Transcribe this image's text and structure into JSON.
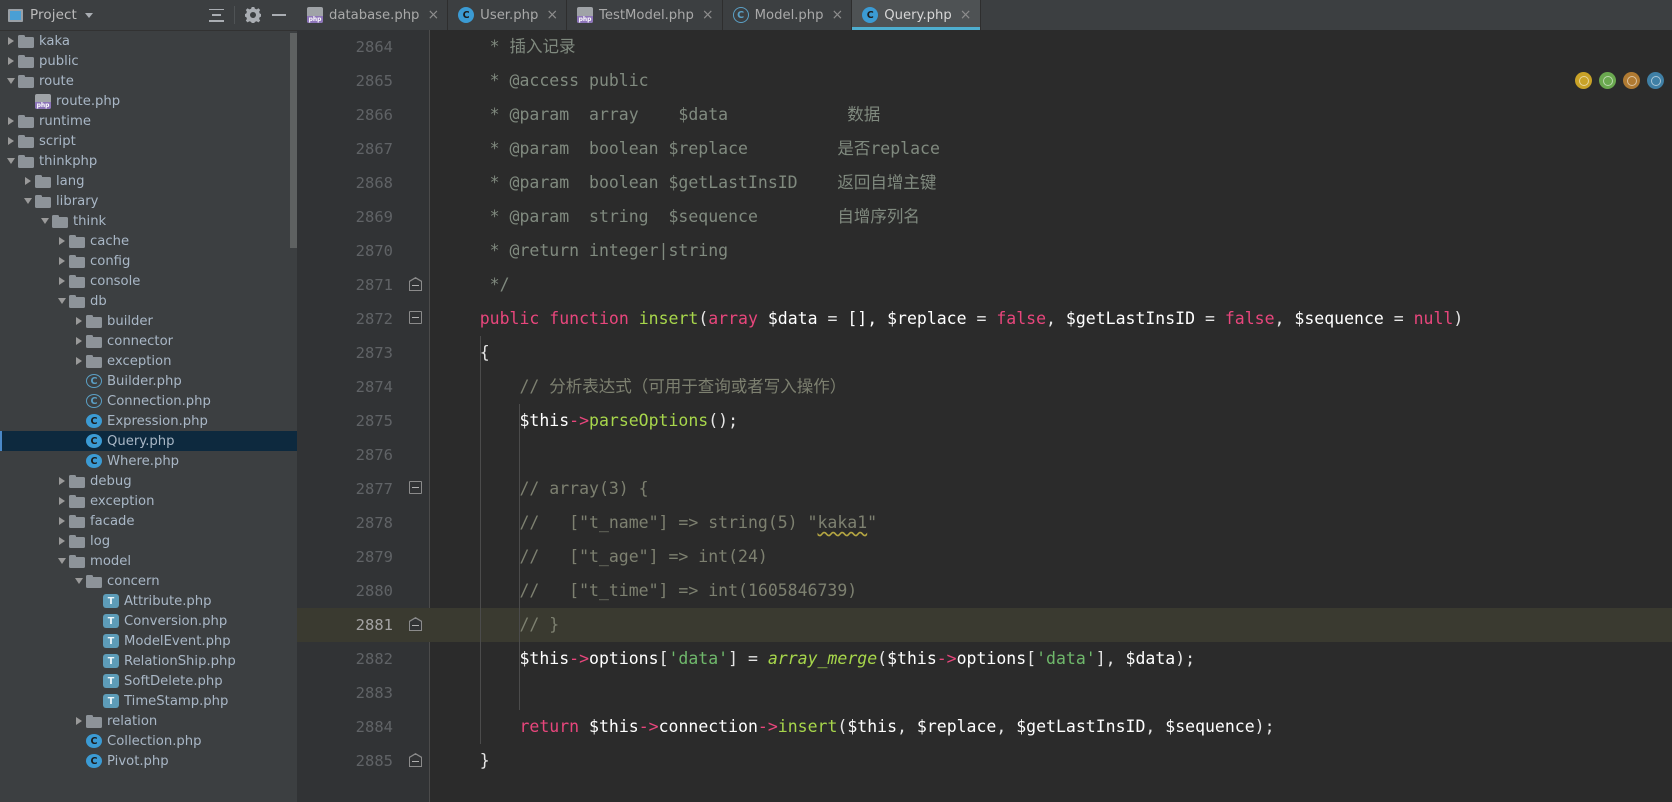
{
  "sidebar": {
    "title": "Project",
    "icons": {
      "project": "project-icon",
      "collapse_all": "collapse-all-icon",
      "settings": "gear-icon",
      "hide": "minimize-icon"
    },
    "tree": [
      {
        "label": "kaka",
        "indent": 1,
        "arrow": "closed",
        "icon": "folder"
      },
      {
        "label": "public",
        "indent": 1,
        "arrow": "closed",
        "icon": "folder"
      },
      {
        "label": "route",
        "indent": 1,
        "arrow": "open",
        "icon": "folder"
      },
      {
        "label": "route.php",
        "indent": 2,
        "arrow": "none",
        "icon": "php"
      },
      {
        "label": "runtime",
        "indent": 1,
        "arrow": "closed",
        "icon": "folder"
      },
      {
        "label": "script",
        "indent": 1,
        "arrow": "closed",
        "icon": "folder"
      },
      {
        "label": "thinkphp",
        "indent": 1,
        "arrow": "open",
        "icon": "folder"
      },
      {
        "label": "lang",
        "indent": 2,
        "arrow": "closed",
        "icon": "folder"
      },
      {
        "label": "library",
        "indent": 2,
        "arrow": "open",
        "icon": "folder"
      },
      {
        "label": "think",
        "indent": 3,
        "arrow": "open",
        "icon": "folder"
      },
      {
        "label": "cache",
        "indent": 4,
        "arrow": "closed",
        "icon": "folder"
      },
      {
        "label": "config",
        "indent": 4,
        "arrow": "closed",
        "icon": "folder"
      },
      {
        "label": "console",
        "indent": 4,
        "arrow": "closed",
        "icon": "folder"
      },
      {
        "label": "db",
        "indent": 4,
        "arrow": "open",
        "icon": "folder"
      },
      {
        "label": "builder",
        "indent": 5,
        "arrow": "closed",
        "icon": "folder"
      },
      {
        "label": "connector",
        "indent": 5,
        "arrow": "closed",
        "icon": "folder"
      },
      {
        "label": "exception",
        "indent": 5,
        "arrow": "closed",
        "icon": "folder"
      },
      {
        "label": "Builder.php",
        "indent": 5,
        "arrow": "none",
        "icon": "abstract"
      },
      {
        "label": "Connection.php",
        "indent": 5,
        "arrow": "none",
        "icon": "abstract"
      },
      {
        "label": "Expression.php",
        "indent": 5,
        "arrow": "none",
        "icon": "class"
      },
      {
        "label": "Query.php",
        "indent": 5,
        "arrow": "none",
        "icon": "class",
        "selected": true
      },
      {
        "label": "Where.php",
        "indent": 5,
        "arrow": "none",
        "icon": "class"
      },
      {
        "label": "debug",
        "indent": 4,
        "arrow": "closed",
        "icon": "folder"
      },
      {
        "label": "exception",
        "indent": 4,
        "arrow": "closed",
        "icon": "folder"
      },
      {
        "label": "facade",
        "indent": 4,
        "arrow": "closed",
        "icon": "folder"
      },
      {
        "label": "log",
        "indent": 4,
        "arrow": "closed",
        "icon": "folder"
      },
      {
        "label": "model",
        "indent": 4,
        "arrow": "open",
        "icon": "folder"
      },
      {
        "label": "concern",
        "indent": 5,
        "arrow": "open",
        "icon": "folder"
      },
      {
        "label": "Attribute.php",
        "indent": 6,
        "arrow": "none",
        "icon": "trait"
      },
      {
        "label": "Conversion.php",
        "indent": 6,
        "arrow": "none",
        "icon": "trait"
      },
      {
        "label": "ModelEvent.php",
        "indent": 6,
        "arrow": "none",
        "icon": "trait"
      },
      {
        "label": "RelationShip.php",
        "indent": 6,
        "arrow": "none",
        "icon": "trait"
      },
      {
        "label": "SoftDelete.php",
        "indent": 6,
        "arrow": "none",
        "icon": "trait"
      },
      {
        "label": "TimeStamp.php",
        "indent": 6,
        "arrow": "none",
        "icon": "trait"
      },
      {
        "label": "relation",
        "indent": 5,
        "arrow": "closed",
        "icon": "folder"
      },
      {
        "label": "Collection.php",
        "indent": 5,
        "arrow": "none",
        "icon": "class"
      },
      {
        "label": "Pivot.php",
        "indent": 5,
        "arrow": "none",
        "icon": "class"
      }
    ]
  },
  "tabs": [
    {
      "label": "database.php",
      "icon": "php",
      "active": false,
      "close": "×"
    },
    {
      "label": "User.php",
      "icon": "class",
      "active": false,
      "close": "×"
    },
    {
      "label": "TestModel.php",
      "icon": "php-mod",
      "active": false,
      "close": "×"
    },
    {
      "label": "Model.php",
      "icon": "abstract",
      "active": false,
      "close": "×"
    },
    {
      "label": "Query.php",
      "icon": "class",
      "active": true,
      "close": "×"
    }
  ],
  "editor": {
    "first_line": 2864,
    "current_line": 2881,
    "lines": [
      {
        "n": 2864,
        "fold": "",
        "tokens": [
          {
            "t": "     * ",
            "c": "c-doc"
          },
          {
            "t": "插入记录",
            "c": "c-doc"
          }
        ]
      },
      {
        "n": 2865,
        "fold": "",
        "tokens": [
          {
            "t": "     * @access public",
            "c": "c-doc"
          }
        ]
      },
      {
        "n": 2866,
        "fold": "",
        "tokens": [
          {
            "t": "     * @param  array    $data            数据",
            "c": "c-doc"
          }
        ]
      },
      {
        "n": 2867,
        "fold": "",
        "tokens": [
          {
            "t": "     * @param  boolean $replace         是否replace",
            "c": "c-doc"
          }
        ]
      },
      {
        "n": 2868,
        "fold": "",
        "tokens": [
          {
            "t": "     * @param  boolean $getLastInsID    返回自增主键",
            "c": "c-doc"
          }
        ]
      },
      {
        "n": 2869,
        "fold": "",
        "tokens": [
          {
            "t": "     * @param  string  $sequence        自增序列名",
            "c": "c-doc"
          }
        ]
      },
      {
        "n": 2870,
        "fold": "",
        "tokens": [
          {
            "t": "     * @return integer|string",
            "c": "c-doc"
          }
        ]
      },
      {
        "n": 2871,
        "fold": "home",
        "tokens": [
          {
            "t": "     */",
            "c": "c-doc"
          }
        ]
      },
      {
        "n": 2872,
        "fold": "box",
        "tokens": [
          {
            "t": "    ",
            "c": "c-txt"
          },
          {
            "t": "public function ",
            "c": "c-kw"
          },
          {
            "t": "insert",
            "c": "c-fn"
          },
          {
            "t": "(",
            "c": "c-punc"
          },
          {
            "t": "array",
            "c": "c-kw"
          },
          {
            "t": " $data ",
            "c": "c-var"
          },
          {
            "t": "=",
            "c": "c-punc"
          },
          {
            "t": " [], ",
            "c": "c-var"
          },
          {
            "t": "$replace ",
            "c": "c-var"
          },
          {
            "t": "=",
            "c": "c-punc"
          },
          {
            "t": " ",
            "c": "c-var"
          },
          {
            "t": "false",
            "c": "c-kw"
          },
          {
            "t": ", ",
            "c": "c-punc"
          },
          {
            "t": "$getLastInsID ",
            "c": "c-var"
          },
          {
            "t": "=",
            "c": "c-punc"
          },
          {
            "t": " ",
            "c": "c-var"
          },
          {
            "t": "false",
            "c": "c-kw"
          },
          {
            "t": ", ",
            "c": "c-punc"
          },
          {
            "t": "$sequence ",
            "c": "c-var"
          },
          {
            "t": "=",
            "c": "c-punc"
          },
          {
            "t": " ",
            "c": "c-var"
          },
          {
            "t": "null",
            "c": "c-kw"
          },
          {
            "t": ")",
            "c": "c-punc"
          }
        ]
      },
      {
        "n": 2873,
        "fold": "",
        "tokens": [
          {
            "t": "    {",
            "c": "c-punc"
          }
        ]
      },
      {
        "n": 2874,
        "fold": "",
        "tokens": [
          {
            "t": "        // 分析表达式（可用于查询或者写入操作）",
            "c": "c-cmt"
          }
        ]
      },
      {
        "n": 2875,
        "fold": "",
        "tokens": [
          {
            "t": "        $this",
            "c": "c-var"
          },
          {
            "t": "->",
            "c": "c-arrow"
          },
          {
            "t": "parseOptions",
            "c": "c-fn"
          },
          {
            "t": "();",
            "c": "c-punc"
          }
        ]
      },
      {
        "n": 2876,
        "fold": "",
        "tokens": [
          {
            "t": "",
            "c": "c-txt"
          }
        ]
      },
      {
        "n": 2877,
        "fold": "box",
        "tokens": [
          {
            "t": "        // array(3) {",
            "c": "c-cmt"
          }
        ]
      },
      {
        "n": 2878,
        "fold": "",
        "tokens": [
          {
            "t": "        //   [\"t_name\"] => string(5) \"kaka1\"",
            "c": "c-cmt",
            "typo": "kaka1"
          }
        ]
      },
      {
        "n": 2879,
        "fold": "",
        "tokens": [
          {
            "t": "        //   [\"t_age\"] => int(24)",
            "c": "c-cmt"
          }
        ]
      },
      {
        "n": 2880,
        "fold": "",
        "tokens": [
          {
            "t": "        //   [\"t_time\"] => int(1605846739)",
            "c": "c-cmt"
          }
        ]
      },
      {
        "n": 2881,
        "fold": "home",
        "cur": true,
        "tokens": [
          {
            "t": "        // }",
            "c": "c-cmt"
          }
        ]
      },
      {
        "n": 2882,
        "fold": "",
        "tokens": [
          {
            "t": "        $this",
            "c": "c-var"
          },
          {
            "t": "->",
            "c": "c-arrow"
          },
          {
            "t": "options",
            "c": "c-var"
          },
          {
            "t": "[",
            "c": "c-punc"
          },
          {
            "t": "'data'",
            "c": "c-str"
          },
          {
            "t": "] ",
            "c": "c-punc"
          },
          {
            "t": "=",
            "c": "c-punc"
          },
          {
            "t": " ",
            "c": "c-punc"
          },
          {
            "t": "array_merge",
            "c": "c-fnbi"
          },
          {
            "t": "(",
            "c": "c-punc"
          },
          {
            "t": "$this",
            "c": "c-var"
          },
          {
            "t": "->",
            "c": "c-arrow"
          },
          {
            "t": "options",
            "c": "c-var"
          },
          {
            "t": "[",
            "c": "c-punc"
          },
          {
            "t": "'data'",
            "c": "c-str"
          },
          {
            "t": "], ",
            "c": "c-punc"
          },
          {
            "t": "$data",
            "c": "c-var"
          },
          {
            "t": ");",
            "c": "c-punc"
          }
        ]
      },
      {
        "n": 2883,
        "fold": "",
        "tokens": [
          {
            "t": "",
            "c": "c-txt"
          }
        ]
      },
      {
        "n": 2884,
        "fold": "",
        "tokens": [
          {
            "t": "        ",
            "c": "c-txt"
          },
          {
            "t": "return",
            "c": "c-kw"
          },
          {
            "t": " $this",
            "c": "c-var"
          },
          {
            "t": "->",
            "c": "c-arrow"
          },
          {
            "t": "connection",
            "c": "c-var"
          },
          {
            "t": "->",
            "c": "c-arrow"
          },
          {
            "t": "insert",
            "c": "c-fn"
          },
          {
            "t": "(",
            "c": "c-punc"
          },
          {
            "t": "$this",
            "c": "c-var"
          },
          {
            "t": ", ",
            "c": "c-punc"
          },
          {
            "t": "$replace",
            "c": "c-var"
          },
          {
            "t": ", ",
            "c": "c-punc"
          },
          {
            "t": "$getLastInsID",
            "c": "c-var"
          },
          {
            "t": ", ",
            "c": "c-punc"
          },
          {
            "t": "$sequence",
            "c": "c-var"
          },
          {
            "t": ");",
            "c": "c-punc"
          }
        ]
      },
      {
        "n": 2885,
        "fold": "home",
        "tokens": [
          {
            "t": "    }",
            "c": "c-punc"
          }
        ]
      }
    ],
    "inspection_widgets": [
      {
        "name": "inspection-warning-indicator",
        "color": "#c9a227"
      },
      {
        "name": "inspection-ok-indicator",
        "color": "#6aa84f"
      },
      {
        "name": "inspection-hector-indicator",
        "color": "#b07a32"
      },
      {
        "name": "inspection-info-indicator",
        "color": "#3f7fa5"
      }
    ]
  },
  "theme": {
    "editor_bg": "#2b2b2b",
    "gutter_bg": "#313335",
    "panel_bg": "#3c3f41",
    "caret_row": "#3a3a30",
    "selection": "#0d293e",
    "accent": "#4eaecf"
  }
}
